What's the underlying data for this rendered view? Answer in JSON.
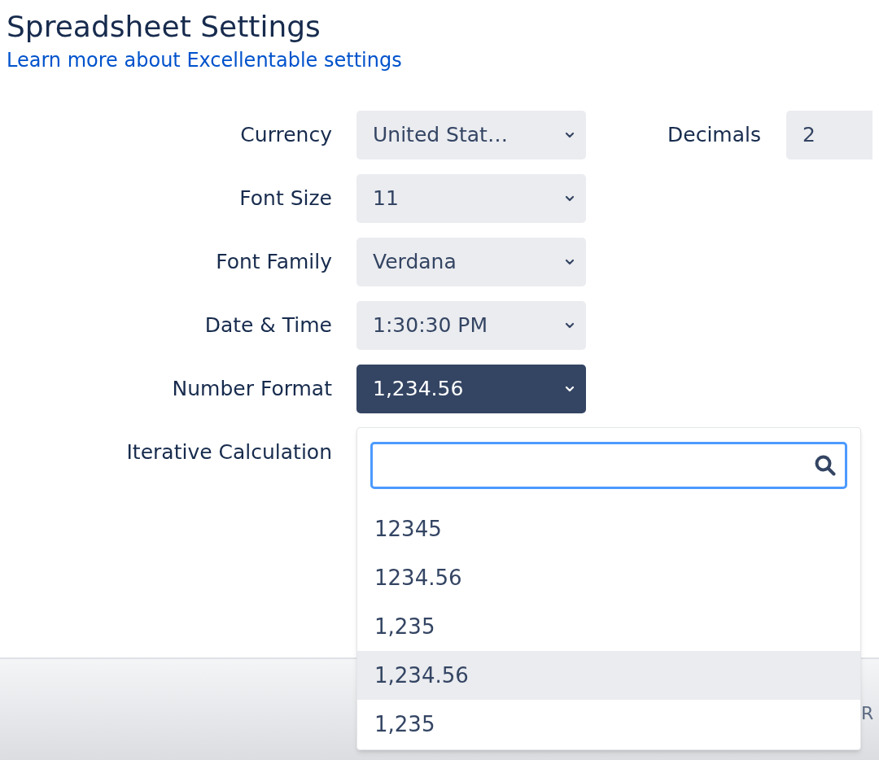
{
  "title": "Spreadsheet Settings",
  "link": "Learn more about Excellentable settings",
  "fields": [
    {
      "label": "Currency",
      "value": "United Stat…",
      "active": false
    },
    {
      "label": "Font Size",
      "value": "11",
      "active": false
    },
    {
      "label": "Font Family",
      "value": "Verdana",
      "active": false
    },
    {
      "label": "Date & Time",
      "value": "1:30:30 PM",
      "active": false
    },
    {
      "label": "Number Format",
      "value": "1,234.56",
      "active": true
    }
  ],
  "decimals": {
    "label": "Decimals",
    "value": "2"
  },
  "iterative": {
    "label": "Iterative Calculation"
  },
  "dropdown": {
    "options": [
      {
        "label": "12345",
        "selected": false
      },
      {
        "label": "1234.56",
        "selected": false
      },
      {
        "label": "1,235",
        "selected": false
      },
      {
        "label": "1,234.56",
        "selected": true
      },
      {
        "label": "1,235",
        "selected": false
      }
    ]
  },
  "footer": {
    "button": "R"
  }
}
